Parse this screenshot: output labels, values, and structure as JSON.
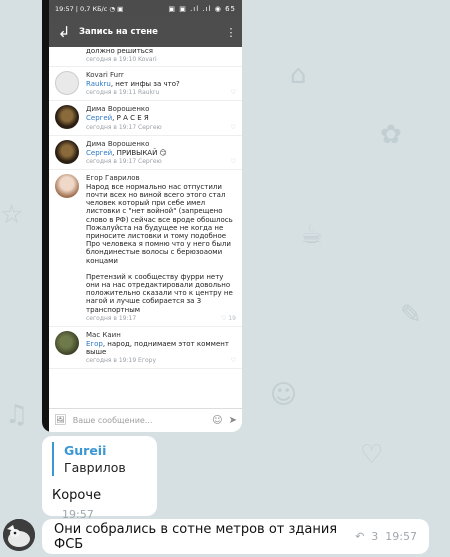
{
  "screenshot": {
    "status_left": "19:57 | 0,7 КБ/с ◔ ▣",
    "status_right": "▣ ▣ .ıl .ıl ◉ 65",
    "header_title": "Запись на стене",
    "top_comment": {
      "text": "должно решиться",
      "meta": "сегодня в 19:10 Kovari"
    },
    "comments": [
      {
        "name": "Kovari Furr",
        "mention": "Raukru",
        "text": ", нет инфы за что?",
        "meta": "сегодня в 19:11 Raukru",
        "likes": ""
      },
      {
        "name": "Дима Ворошенко",
        "mention": "Сергей",
        "text": ", Р А С Е Я",
        "meta": "сегодня в 19:17 Сергею",
        "likes": ""
      },
      {
        "name": "Дима Ворошенко",
        "mention": "Сергей",
        "text": ", ПРИВЫКАЙ 😏",
        "meta": "сегодня в 19:17 Сергею",
        "likes": ""
      },
      {
        "name": "Егор Гаврилов",
        "mention": "",
        "text": "Народ все нормально нас отпустили почти всех но виной всего этого стал человек который при себе имел листовки с \"нет войной\" (запрещено слово в РФ) сейчас все вроде обошлось Пожалуйста на будущее не когда не приносите листовки и тому подобное Про человека я помню что у него были блондинестые волосы с берюзоаоми концами",
        "text2": "Претензий к сообществу фурри нету они на нас отредактировали довольно положительно сказали что к центру не нагой и лучше собирается за 3 транспортным",
        "meta": "сегодня в 19:17",
        "likes": "♡ 19"
      },
      {
        "name": "Мас Каин",
        "mention": "Егор",
        "text": ", народ, поднимаем этот коммент выше",
        "meta": "сегодня в 19:19 Егору",
        "likes": ""
      }
    ],
    "input_placeholder": "Ваше сообщение..."
  },
  "reply": {
    "quote_name": "Gureii",
    "quote_text": "Гаврилов",
    "text": "Короче",
    "time": "19:57"
  },
  "last": {
    "text": "Они собрались в сотне метров от здания ФСБ",
    "replies": "3",
    "time": "19:57"
  }
}
